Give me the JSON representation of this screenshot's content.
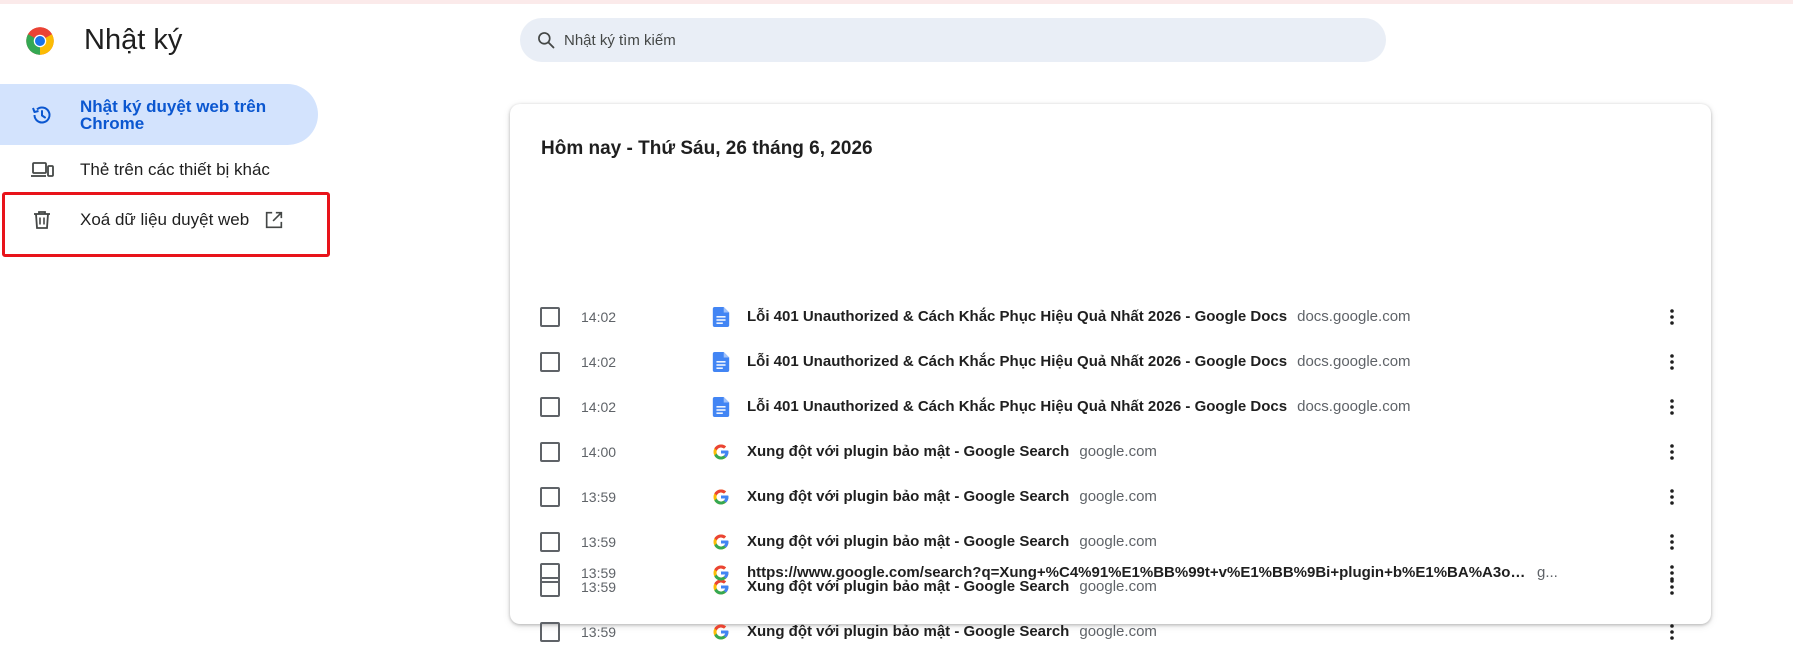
{
  "header": {
    "title": "Nhật ký",
    "search_placeholder": "Nhật ký tìm kiếm"
  },
  "sidebar": {
    "items": [
      {
        "label": "Nhật ký duyệt web trên Chrome",
        "icon": "history-icon",
        "active": true
      },
      {
        "label": "Thẻ trên các thiết bị khác",
        "icon": "devices-icon",
        "active": false
      },
      {
        "label": "Xoá dữ liệu duyệt web",
        "icon": "trash-icon",
        "active": false,
        "external": true
      }
    ]
  },
  "colors": {
    "accent": "#0b57d0",
    "active_bg": "#d3e3fd",
    "highlight": "#e8131a",
    "search_bg": "#e9eef6"
  },
  "history": {
    "day_title": "Hôm nay - Thứ Sáu, 26 tháng 6, 2026",
    "rows": [
      {
        "time": "14:02",
        "favicon": "google-docs-icon",
        "title": "Lỗi 401 Unauthorized & Cách Khắc Phục Hiệu Quả Nhất 2026 - Google Docs",
        "domain": "docs.google.com"
      },
      {
        "time": "14:02",
        "favicon": "google-docs-icon",
        "title": "Lỗi 401 Unauthorized & Cách Khắc Phục Hiệu Quả Nhất 2026 - Google Docs",
        "domain": "docs.google.com"
      },
      {
        "time": "14:02",
        "favicon": "google-docs-icon",
        "title": "Lỗi 401 Unauthorized & Cách Khắc Phục Hiệu Quả Nhất 2026 - Google Docs",
        "domain": "docs.google.com"
      },
      {
        "time": "14:00",
        "favicon": "google-g-icon",
        "title": "Xung đột với plugin bảo mật - Google Search",
        "domain": "google.com"
      },
      {
        "time": "13:59",
        "favicon": "google-g-icon",
        "title": "Xung đột với plugin bảo mật - Google Search",
        "domain": "google.com"
      },
      {
        "time": "13:59",
        "favicon": "google-g-icon",
        "title": "Xung đột với plugin bảo mật - Google Search",
        "domain": "google.com"
      },
      {
        "time": "13:59",
        "favicon": "google-g-icon",
        "title": "Xung đột với plugin bảo mật - Google Search",
        "domain": "google.com"
      },
      {
        "time": "13:59",
        "favicon": "google-g-icon",
        "title": "Xung đột với plugin bảo mật - Google Search",
        "domain": "google.com"
      },
      {
        "time": "13:59",
        "favicon": "google-g-icon",
        "title": "https://www.google.com/search?q=Xung+%C4%91%E1%BB%99t+v%E1%BB%9Bi+plugin+b%E1%BA%A3o+m%E1%BA%ADt...",
        "domain": "g..."
      }
    ]
  }
}
